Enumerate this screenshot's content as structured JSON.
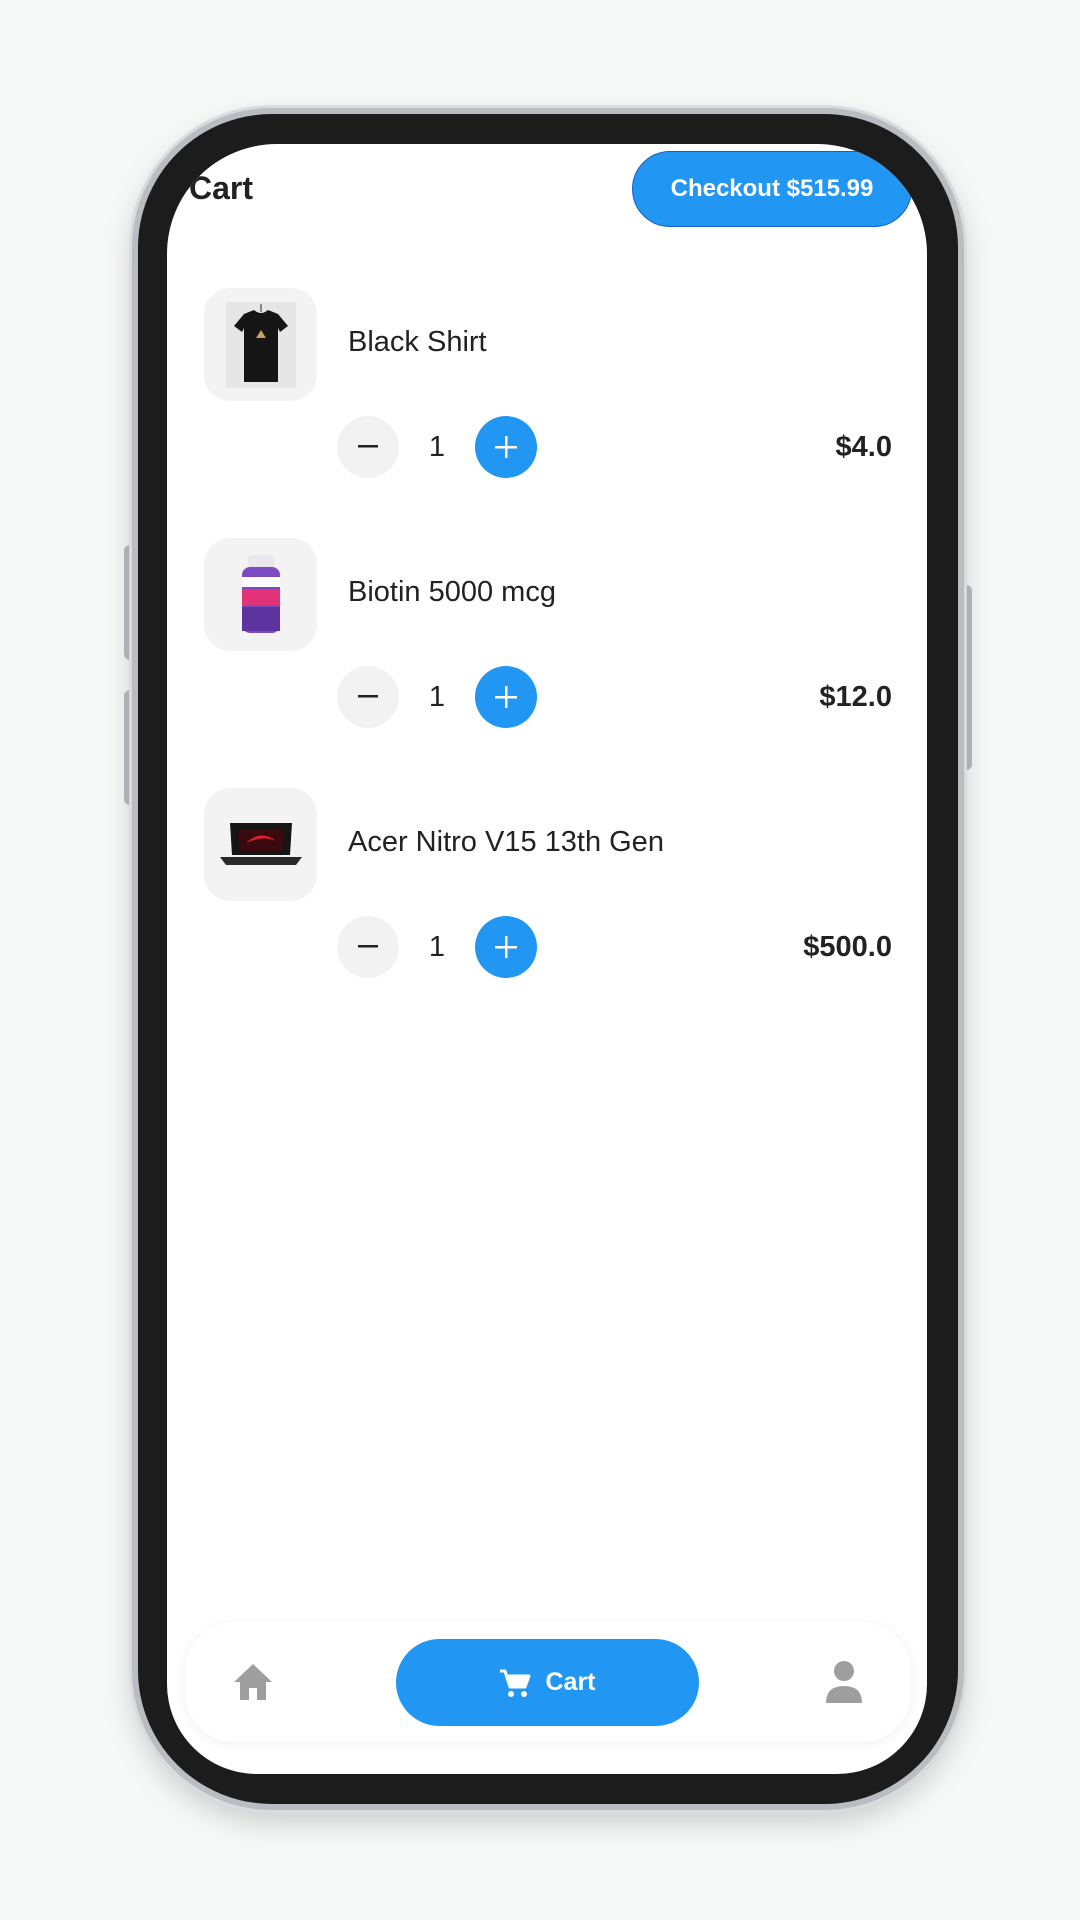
{
  "header": {
    "title": "Cart",
    "checkout_label": "Checkout $515.99"
  },
  "items": [
    {
      "name": "Black Shirt",
      "quantity": "1",
      "price": "$4.0",
      "image_icon": "black-shirt-image"
    },
    {
      "name": "Biotin 5000 mcg",
      "quantity": "1",
      "price": "$12.0",
      "image_icon": "biotin-bottle-image"
    },
    {
      "name": "Acer Nitro V15 13th Gen",
      "quantity": "1",
      "price": "$500.0",
      "image_icon": "laptop-image"
    }
  ],
  "bottom_nav": {
    "home_icon": "home-icon",
    "cart_label": "Cart",
    "cart_icon": "cart-icon",
    "profile_icon": "person-icon"
  },
  "colors": {
    "accent": "#2196f3",
    "text": "#222222",
    "thumb_bg": "#f3f3f3",
    "minus_bg": "#f2f2f2",
    "nav_icon": "#9e9e9e"
  }
}
